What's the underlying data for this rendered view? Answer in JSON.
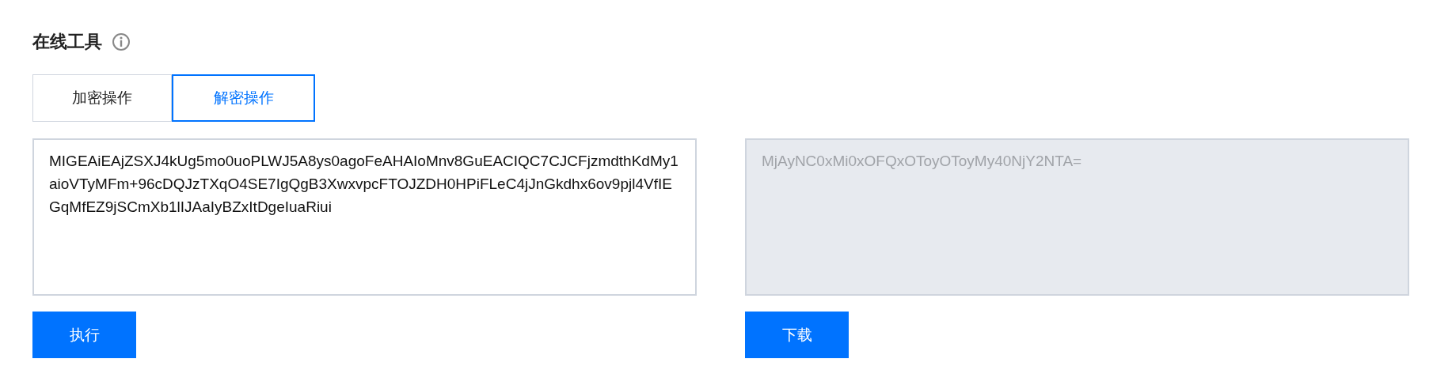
{
  "title": "在线工具",
  "tabs": [
    {
      "label": "加密操作",
      "selected": false
    },
    {
      "label": "解密操作",
      "selected": true
    }
  ],
  "input": {
    "value": "MIGEAiEAjZSXJ4kUg5mo0uoPLWJ5A8ys0agoFeAHAIoMnv8GuEACIQC7CJCFjzmdthKdMy1aioVTyMFm+96cDQJzTXqO4SE7IgQgB3XwxvpcFTOJZDH0HPiFLeC4jJnGkdhx6ov9pjl4VfIEGqMfEZ9jSCmXb1lIJAaIyBZxItDgeIuaRiui",
    "disabled": false
  },
  "output": {
    "value": "MjAyNC0xMi0xOFQxOToyOToyMy40NjY2NTA=",
    "disabled": true
  },
  "buttons": [
    "执行",
    "下载"
  ]
}
